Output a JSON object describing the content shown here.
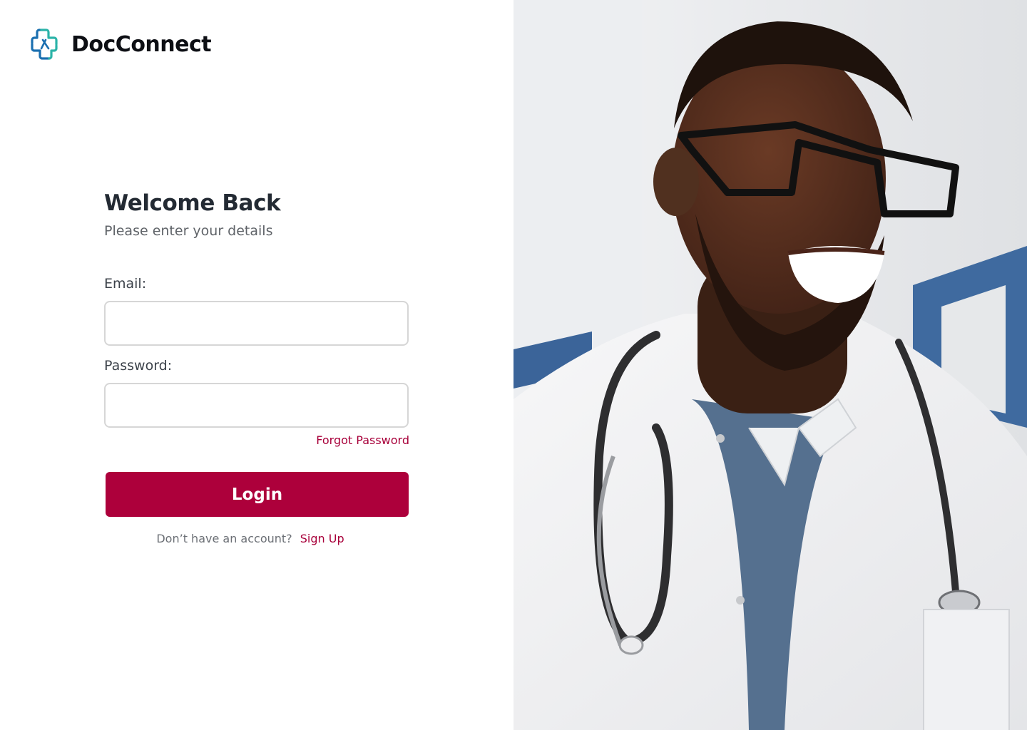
{
  "brand": {
    "name": "DocConnect",
    "logo_icon": "medical-cross-icon",
    "logo_colors": [
      "#1a6fb0",
      "#2bb3a8"
    ]
  },
  "login": {
    "title": "Welcome Back",
    "subtitle": "Please enter your details",
    "email_label": "Email:",
    "email_value": "",
    "password_label": "Password:",
    "password_value": "",
    "forgot_password": "Forgot Password",
    "submit_label": "Login",
    "signup_prompt": "Don’t have an account?",
    "signup_link": "Sign Up"
  },
  "hero": {
    "image": "smiling-doctor-photo"
  },
  "colors": {
    "accent": "#ad003b",
    "link": "#a8003a",
    "heading": "#232a33",
    "input_border": "#d6d6d6"
  }
}
